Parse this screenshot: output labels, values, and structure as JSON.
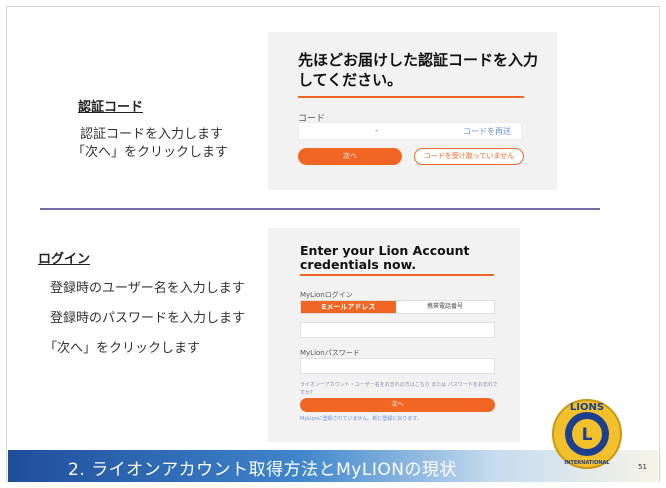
{
  "auth_section": {
    "heading": "認証コード",
    "lines": [
      "認証コードを入力します",
      "「次へ」をクリックします"
    ]
  },
  "auth_panel": {
    "title": "先ほどお届けした認証コードを入力してください。",
    "code_label": "コード",
    "code_value": "-",
    "resend_link": "コードを再送",
    "next_button": "次へ",
    "not_received_button": "コードを受け取っていません"
  },
  "login_section": {
    "heading": "ログイン",
    "lines": [
      "登録時のユーザー名を入力します",
      "登録時のパスワードを入力します",
      "「次へ」をクリックします"
    ]
  },
  "login_panel": {
    "title": "Enter your Lion Account credentials now.",
    "login_label": "MyLionログイン",
    "tab_email": "Eメールアドレス",
    "tab_phone": "携帯電話番号",
    "password_label": "MyLionパスワード",
    "help_text": "ライオンーアカウント・ユーザー名をお忘れの方はこちら または パスワードをお忘れですか?",
    "next_button": "次へ",
    "footer_note": "MyLionに登録されていません。新に登録に戻ります。"
  },
  "footer": {
    "banner": "2. ライオンアカウント取得方法とMyLIONの現状",
    "page_number": "51"
  },
  "logo": {
    "top_text": "LIONS",
    "bottom_text": "INTERNATIONAL",
    "letter": "L"
  },
  "colors": {
    "accent": "#f26522",
    "divider": "#7a6aa8",
    "banner_start": "#1f4d9c",
    "logo_gold": "#f2c02b",
    "logo_blue": "#1d3f8f"
  }
}
